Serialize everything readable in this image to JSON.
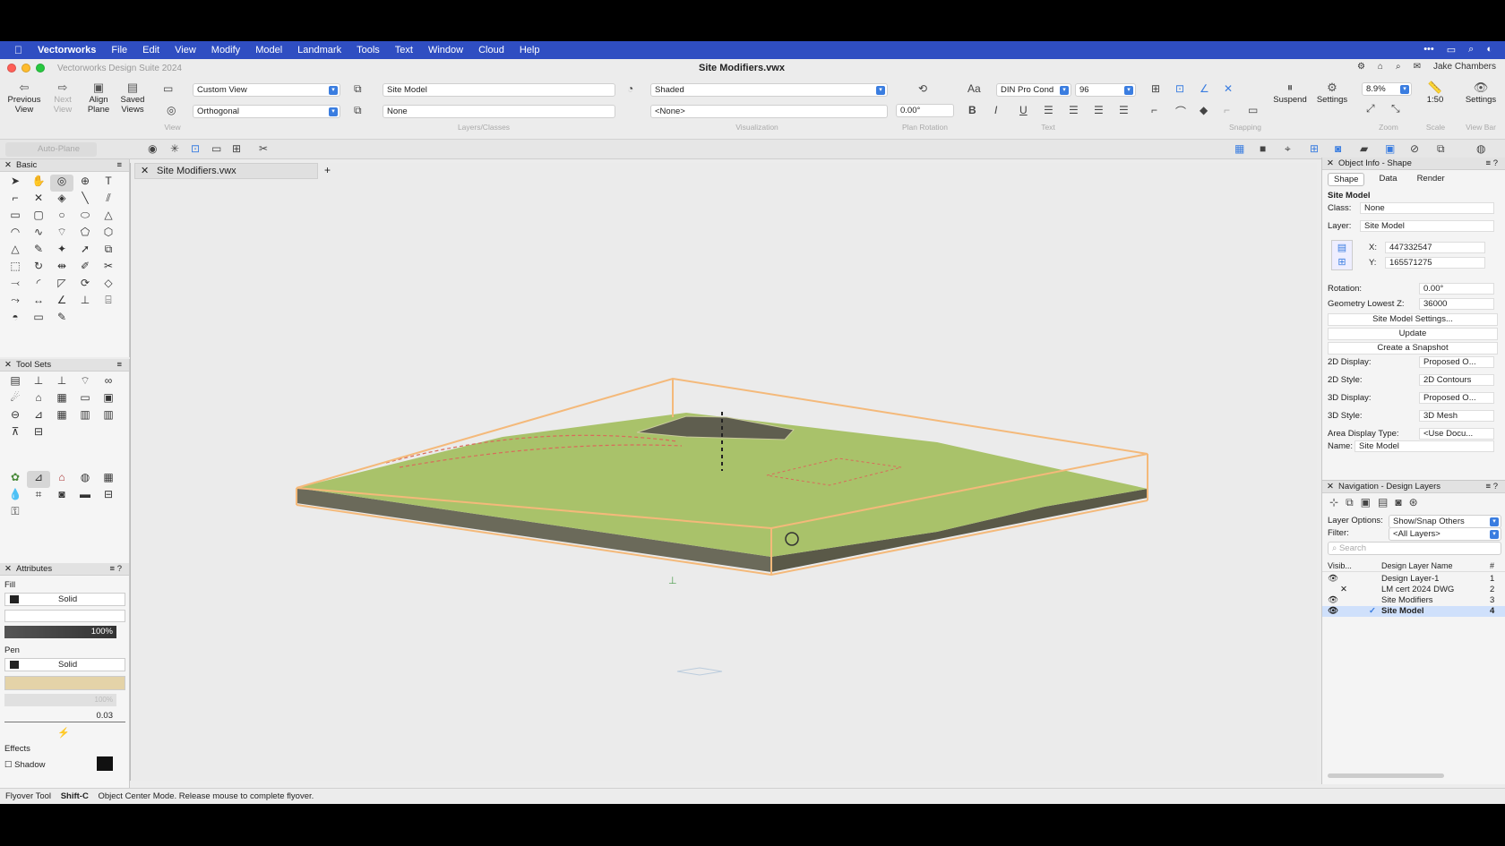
{
  "menubar": {
    "app": "Vectorworks",
    "items": [
      "File",
      "Edit",
      "View",
      "Modify",
      "Model",
      "Landmark",
      "Tools",
      "Text",
      "Window",
      "Cloud",
      "Help"
    ]
  },
  "titlebar": {
    "app_title": "Vectorworks Design Suite 2024",
    "doc_title": "Site Modifiers.vwx",
    "user": "Jake Chambers"
  },
  "toolbar": {
    "previous_view": "Previous View",
    "next_view": "Next View",
    "align_plane": "Align Plane",
    "saved_views": "Saved Views",
    "view_combo": "Custom View",
    "projection_combo": "Orthogonal",
    "group_view": "View",
    "layer_combo": "Site Model",
    "class_combo": "None",
    "group_layers": "Layers/Classes",
    "render_combo": "Shaded",
    "render_style_combo": "<None>",
    "group_visualization": "Visualization",
    "plan_rotation_value": "0.00°",
    "group_plan_rotation": "Plan Rotation",
    "font_combo": "DIN Pro Cond",
    "font_size_combo": "96",
    "group_text": "Text",
    "group_snapping": "Snapping",
    "suspend": "Suspend",
    "settings": "Settings",
    "zoom_value": "8.9%",
    "group_zoom": "Zoom",
    "scale_value": "1:50",
    "group_scale": "Scale",
    "view_bar_settings": "Settings",
    "group_view_bar": "View Bar",
    "auto_plane": "Auto-Plane"
  },
  "basic_palette": {
    "title": "Basic"
  },
  "toolsets_palette": {
    "title": "Tool Sets"
  },
  "attributes": {
    "title": "Attributes",
    "fill_label": "Fill",
    "fill_style": "Solid",
    "fill_opacity": "100%",
    "pen_label": "Pen",
    "pen_style": "Solid",
    "pen_opacity": "100%",
    "line_weight": "0.03",
    "effects_label": "Effects",
    "shadow_label": "Shadow"
  },
  "document_tab": {
    "title": "Site Modifiers.vwx"
  },
  "object_info": {
    "title": "Object Info - Shape",
    "tabs": [
      "Shape",
      "Data",
      "Render"
    ],
    "object_type": "Site Model",
    "class_label": "Class:",
    "class_value": "None",
    "layer_label": "Layer:",
    "layer_value": "Site Model",
    "x_label": "X:",
    "x_value": "447332547",
    "y_label": "Y:",
    "y_value": "165571275",
    "rotation_label": "Rotation:",
    "rotation_value": "0.00°",
    "geom_label": "Geometry Lowest Z:",
    "geom_value": "36000",
    "btn_settings": "Site Model Settings...",
    "btn_update": "Update",
    "btn_snapshot": "Create a Snapshot",
    "disp2d_label": "2D Display:",
    "disp2d_value": "Proposed O...",
    "style2d_label": "2D Style:",
    "style2d_value": "2D Contours",
    "disp3d_label": "3D Display:",
    "disp3d_value": "Proposed O...",
    "style3d_label": "3D Style:",
    "style3d_value": "3D Mesh",
    "area_label": "Area Display Type:",
    "area_value": "<Use Docu...",
    "name_label": "Name:",
    "name_value": "Site Model"
  },
  "navigation": {
    "title": "Navigation - Design Layers",
    "layer_options_label": "Layer Options:",
    "layer_options_value": "Show/Snap Others",
    "filter_label": "Filter:",
    "filter_value": "<All Layers>",
    "search_placeholder": "Search",
    "col_visibility": "Visib...",
    "col_name": "Design Layer Name",
    "col_number": "#",
    "layers": [
      {
        "name": "Design Layer-1",
        "num": "1"
      },
      {
        "name": "LM cert 2024 DWG",
        "num": "2"
      },
      {
        "name": "Site Modifiers",
        "num": "3"
      },
      {
        "name": "Site Model",
        "num": "4"
      }
    ]
  },
  "status": {
    "tool": "Flyover Tool",
    "shortcut": "Shift-C",
    "message": "Object Center Mode. Release mouse to complete flyover."
  },
  "colors": {
    "menubar": "#2f4ec2",
    "terrain_top": "#a9c26a",
    "terrain_side": "#6b6a5a",
    "bbox": "#f4b97a",
    "accent": "#3a7de0"
  }
}
